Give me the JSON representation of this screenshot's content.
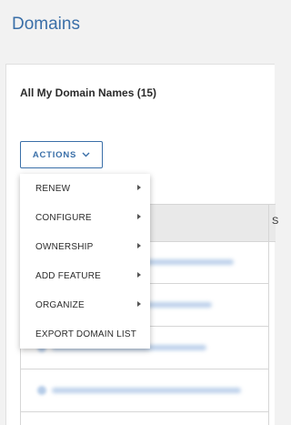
{
  "page": {
    "title": "Domains"
  },
  "card": {
    "heading": "All My Domain Names (15)",
    "actions_label": "ACTIONS",
    "actions_icon": "chevron-down-icon"
  },
  "table": {
    "col2_header_partial": "S"
  },
  "actions_menu": {
    "items": [
      {
        "label": "RENEW",
        "has_submenu": true
      },
      {
        "label": "CONFIGURE",
        "has_submenu": true
      },
      {
        "label": "OWNERSHIP",
        "has_submenu": true
      },
      {
        "label": "ADD FEATURE",
        "has_submenu": true
      },
      {
        "label": "ORGANIZE",
        "has_submenu": true
      },
      {
        "label": "EXPORT DOMAIN LIST",
        "has_submenu": false
      }
    ]
  },
  "colors": {
    "accent": "#3a6fa8",
    "background": "#f2f2f2",
    "link_blurred": "#7aa3d6"
  }
}
